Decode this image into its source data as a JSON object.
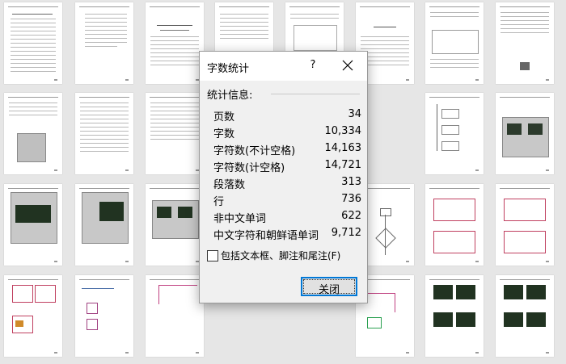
{
  "dialog": {
    "title": "字数统计",
    "help_glyph": "?",
    "section_label": "统计信息:",
    "stats": [
      {
        "label": "页数",
        "value": "34"
      },
      {
        "label": "字数",
        "value": "10,334"
      },
      {
        "label": "字符数(不计空格)",
        "value": "14,163"
      },
      {
        "label": "字符数(计空格)",
        "value": "14,721"
      },
      {
        "label": "段落数",
        "value": "313"
      },
      {
        "label": "行",
        "value": "736"
      },
      {
        "label": "非中文单词",
        "value": "622"
      },
      {
        "label": "中文字符和朝鲜语单词",
        "value": "9,712"
      }
    ],
    "checkbox_label": "包括文本框、脚注和尾注(F)",
    "checkbox_checked": false,
    "close_button_label": "关闭"
  },
  "accent_color": "#0078d7"
}
